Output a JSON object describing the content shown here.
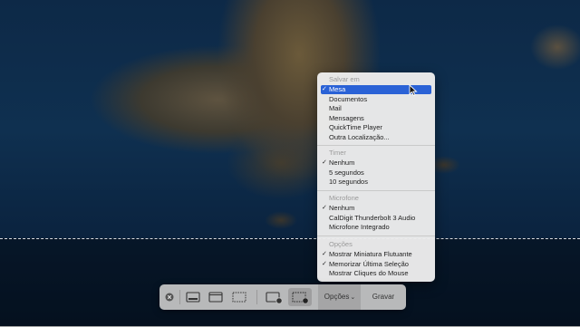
{
  "options_menu": {
    "save_to": {
      "title": "Salvar em",
      "items": [
        "Mesa",
        "Documentos",
        "Mail",
        "Mensagens",
        "QuickTime Player",
        "Outra Localização..."
      ],
      "checked": "Mesa",
      "highlighted": "Mesa"
    },
    "timer": {
      "title": "Timer",
      "items": [
        "Nenhum",
        "5 segundos",
        "10 segundos"
      ],
      "checked": "Nenhum"
    },
    "microphone": {
      "title": "Microfone",
      "items": [
        "Nenhum",
        "CalDigit Thunderbolt 3 Audio",
        "Microfone Integrado"
      ],
      "checked": "Nenhum"
    },
    "options": {
      "title": "Opções",
      "items": [
        "Mostrar Miniatura Flutuante",
        "Memorizar Última Seleção",
        "Mostrar Cliques do Mouse"
      ],
      "checked": [
        "Mostrar Miniatura Flutuante",
        "Memorizar Última Seleção"
      ]
    },
    "check_glyph": "✓"
  },
  "toolbar": {
    "options_label": "Opções",
    "options_chevron": "⌄",
    "record_label": "Gravar",
    "icons": [
      "close-icon",
      "capture-screen-icon",
      "capture-window-icon",
      "capture-selection-icon",
      "record-screen-icon",
      "record-selection-icon"
    ]
  },
  "colors": {
    "highlight": "#2a62d6"
  }
}
